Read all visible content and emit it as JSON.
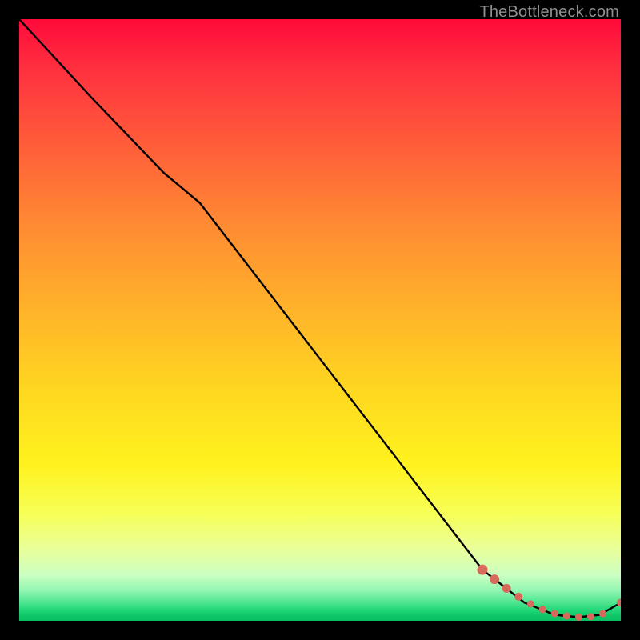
{
  "attribution": "TheBottleneck.com",
  "colors": {
    "page_bg": "#000000",
    "line": "#000000",
    "scatter": "#d86a5c",
    "gradient_top": "#ff0a3a",
    "gradient_bottom": "#08c063"
  },
  "chart_data": {
    "type": "line",
    "title": "",
    "xlabel": "",
    "ylabel": "",
    "xlim": [
      0,
      100
    ],
    "ylim": [
      0,
      100
    ],
    "grid": false,
    "legend": false,
    "series": [
      {
        "name": "bottleneck-curve",
        "style": "solid-black",
        "x": [
          0.0,
          12.0,
          24.0,
          30.0,
          77.0,
          84.0,
          89.0,
          93.0,
          96.5,
          100.0
        ],
        "y": [
          100.0,
          87.0,
          74.5,
          69.5,
          8.5,
          3.0,
          1.0,
          0.6,
          1.0,
          3.0
        ]
      },
      {
        "name": "highlight-dots",
        "style": "thick-dotted-red",
        "x": [
          77.0,
          79.0,
          81.0,
          83.0,
          85.0,
          87.0,
          89.0,
          91.0,
          93.0,
          95.0,
          97.0,
          100.0
        ],
        "y": [
          8.5,
          6.9,
          5.4,
          4.0,
          2.8,
          1.9,
          1.2,
          0.8,
          0.6,
          0.7,
          1.2,
          3.0
        ]
      }
    ],
    "annotations": [
      {
        "text": "TheBottleneck.com",
        "position": "top-right"
      }
    ]
  }
}
